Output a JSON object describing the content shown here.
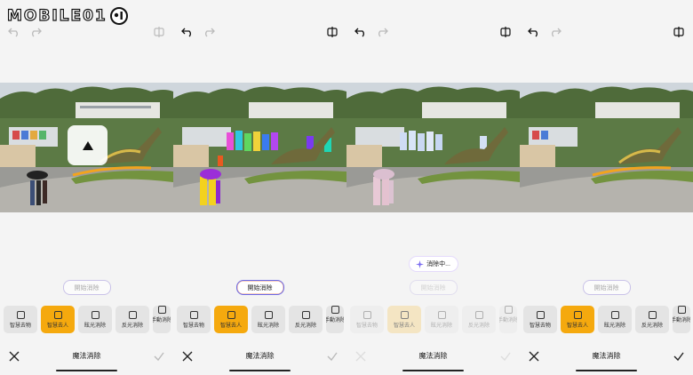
{
  "watermark": {
    "text": "MOBILE01"
  },
  "action_labels": {
    "start_removal": "開始消除",
    "removing": "消除中..."
  },
  "tools": [
    {
      "label": "智慧去物",
      "icon": "erase-object-icon"
    },
    {
      "label": "智慧去人",
      "icon": "erase-person-icon"
    },
    {
      "label": "眩光消除",
      "icon": "glare-icon"
    },
    {
      "label": "反光消除",
      "icon": "reflection-icon"
    },
    {
      "label": "手動消除",
      "icon": "manual-erase-icon"
    }
  ],
  "bottom": {
    "title": "魔法消除"
  },
  "panels": [
    {
      "state": "video-paused"
    },
    {
      "state": "people-selected",
      "selected_tool": "智慧去人"
    },
    {
      "state": "processing"
    },
    {
      "state": "result",
      "selected_tool": "智慧去人"
    }
  ]
}
